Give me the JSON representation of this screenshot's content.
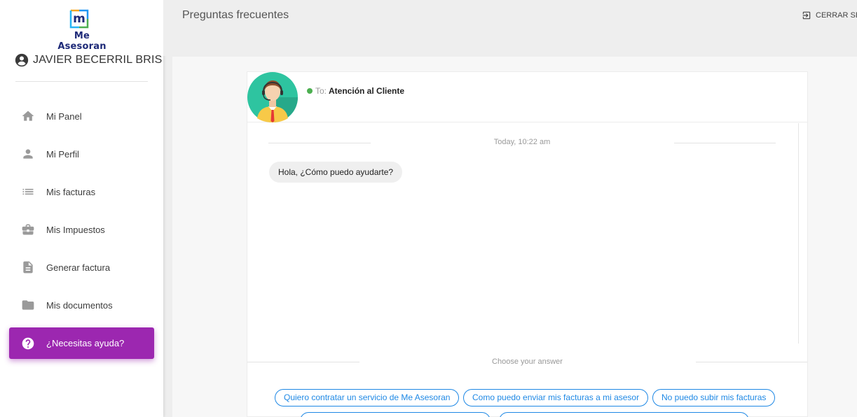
{
  "brand": {
    "logo_letter": "m",
    "logo_text": "Me Asesoran"
  },
  "user": {
    "name": "JAVIER BECERRIL BRIS"
  },
  "nav": {
    "items": [
      {
        "label": "Mi Panel",
        "icon": "home-icon"
      },
      {
        "label": "Mi Perfil",
        "icon": "person-icon"
      },
      {
        "label": "Mis facturas",
        "icon": "list-icon"
      },
      {
        "label": "Mis Impuestos",
        "icon": "briefcase-icon"
      },
      {
        "label": "Generar factura",
        "icon": "document-icon"
      },
      {
        "label": "Mis documentos",
        "icon": "folder-icon"
      },
      {
        "label": "¿Necesitas ayuda?",
        "icon": "help-icon",
        "active": true
      }
    ]
  },
  "header": {
    "title": "Preguntas frecuentes",
    "logout_label": "CERRAR SES"
  },
  "chat": {
    "to_prefix": "To:",
    "to_name": "Atención al Cliente",
    "status": "online",
    "date_label": "Today, 10:22 am",
    "messages": [
      {
        "from": "agent",
        "text": "Hola, ¿Cómo puedo ayudarte?"
      }
    ],
    "choose_label": "Choose your answer",
    "options": [
      "Quiero contratar un servicio de Me Asesoran",
      "Como puedo enviar mis facturas a mi asesor",
      "No puedo subir mis facturas"
    ]
  },
  "colors": {
    "accent": "#9c27b0",
    "option_blue": "#1e88e5",
    "online": "#4caf50",
    "brand_navy": "#1e2a78"
  }
}
